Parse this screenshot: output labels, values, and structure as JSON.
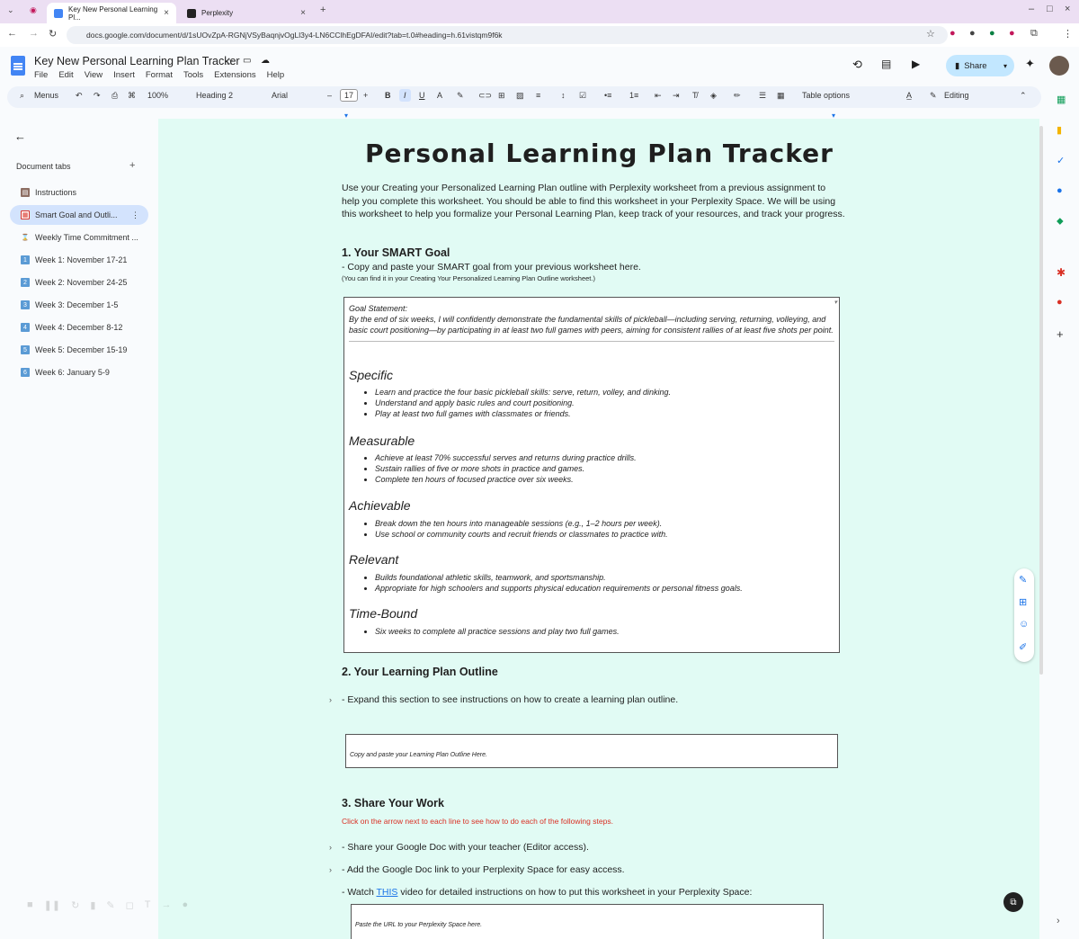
{
  "browser": {
    "tabs": [
      {
        "title": "Key New Personal Learning Pl...",
        "active": true
      },
      {
        "title": "Perplexity",
        "active": false
      }
    ],
    "url": "docs.google.com/document/d/1sUOvZpA-RGNjVSyBaqnjvOgLl3y4-LN6CClhEgDFAI/edit?tab=t.0#heading=h.61vistqm9f6k"
  },
  "doc": {
    "title": "Key New Personal Learning Plan Tracker",
    "menu": [
      "File",
      "Edit",
      "View",
      "Insert",
      "Format",
      "Tools",
      "Extensions",
      "Help"
    ],
    "share_label": "Share"
  },
  "toolbar": {
    "menus_label": "Menus",
    "zoom": "100%",
    "style": "Heading 2",
    "font": "Arial",
    "font_size": "17",
    "table_options": "Table options",
    "mode": "Editing"
  },
  "sidebar": {
    "header": "Document tabs",
    "items": [
      {
        "label": "Instructions",
        "icon": "books-icon"
      },
      {
        "label": "Smart Goal and Outli...",
        "icon": "calendar-icon"
      },
      {
        "label": "Weekly Time Commitment ...",
        "icon": "hourglass-icon"
      },
      {
        "label": "Week 1: November 17-21",
        "icon": "1"
      },
      {
        "label": "Week 2: November 24-25",
        "icon": "2"
      },
      {
        "label": "Week 3: December 1-5",
        "icon": "3"
      },
      {
        "label": "Week 4: December 8-12",
        "icon": "4"
      },
      {
        "label": "Week 5: December 15-19",
        "icon": "5"
      },
      {
        "label": "Week 6: January 5-9",
        "icon": "6"
      }
    ]
  },
  "content": {
    "title": "Personal Learning Plan Tracker",
    "intro": "Use your Creating your Personalized Learning Plan outline with Perplexity worksheet from a previous assignment to help you complete this worksheet.  You should be able to find this worksheet in your Perplexity Space.  We will be using this worksheet to help you formalize your Personal Learning Plan, keep track of your resources, and track your progress.",
    "s1_heading": "1. Your SMART Goal",
    "s1_line": "- Copy and paste your SMART goal from your previous worksheet here.",
    "s1_note": "(You can find it in your Creating Your Personalized Learning Plan Outline worksheet.)",
    "goal_label": "Goal Statement:",
    "goal_text": "By the end of six weeks, I will confidently demonstrate the fundamental skills of pickleball—including serving, returning, volleying, and basic court positioning—by participating in at least two full games with peers, aiming for consistent rallies of at least five shots per point.",
    "specific_h": "Specific",
    "specific": [
      "Learn and practice the four basic pickleball skills: serve, return, volley, and dinking.",
      "Understand and apply basic rules and court positioning.",
      "Play at least two full games with classmates or friends."
    ],
    "measurable_h": "Measurable",
    "measurable": [
      "Achieve at least 70% successful serves and returns during practice drills.",
      "Sustain rallies of five or more shots in practice and games.",
      "Complete ten hours of focused practice over six weeks."
    ],
    "achievable_h": "Achievable",
    "achievable": [
      "Break down the ten hours into manageable sessions (e.g., 1–2 hours per week).",
      "Use school or community courts and recruit friends or classmates to practice with."
    ],
    "relevant_h": "Relevant",
    "relevant": [
      "Builds foundational athletic skills, teamwork, and sportsmanship.",
      "Appropriate for high schoolers and supports physical education requirements or personal fitness goals."
    ],
    "timebound_h": "Time-Bound",
    "timebound": [
      "Six weeks to complete all practice sessions and play two full games."
    ],
    "s2_heading": "2. Your Learning Plan Outline",
    "s2_line": "- Expand this section to see instructions on how to create a learning plan outline.",
    "s2_box": "Copy and paste your Learning Plan Outline Here.",
    "s3_heading": "3. Share Your Work",
    "s3_red": "Click on the arrow next to each line to see how to do each of the following steps.",
    "s3_line1": "- Share your Google Doc with your teacher (Editor access).",
    "s3_line2": "- Add the Google Doc link to your Perplexity Space for easy access.",
    "s3_line3_pre": "-  Watch ",
    "s3_line3_link": "THIS",
    "s3_line3_post": " video for detailed instructions on how to put this worksheet in your Perplexity Space:",
    "s3_box": "Paste the URL to your Perplexity Space here."
  },
  "colors": {
    "page_bg": "#e1fbf4",
    "accent": "#1a73e8",
    "share_bg": "#c2e7ff",
    "red_note": "#d93025"
  }
}
